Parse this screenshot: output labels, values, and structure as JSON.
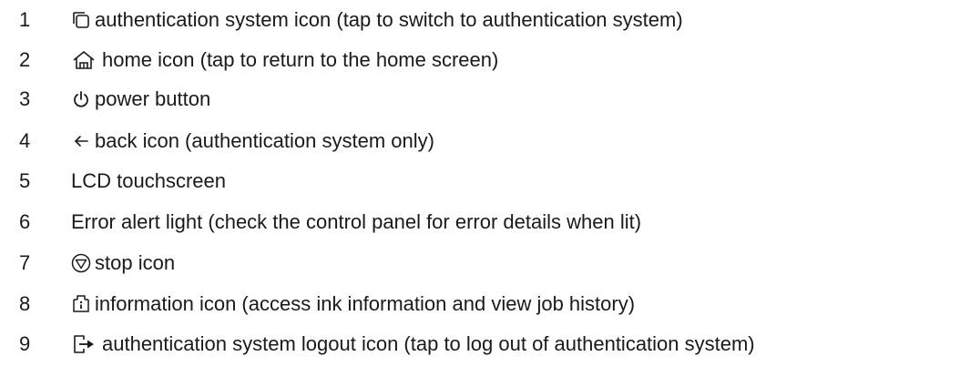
{
  "items": [
    {
      "number": "1",
      "icon": "authentication-system-icon",
      "text": "authentication system icon (tap to switch to authentication system)"
    },
    {
      "number": "2",
      "icon": "home-icon",
      "text": "home icon (tap to return to the home screen)"
    },
    {
      "number": "3",
      "icon": "power-icon",
      "text": "power button"
    },
    {
      "number": "4",
      "icon": "back-arrow-icon",
      "text": "back icon (authentication system only)"
    },
    {
      "number": "5",
      "icon": "",
      "text": "LCD touchscreen"
    },
    {
      "number": "6",
      "icon": "",
      "text": "Error alert light (check the control panel for error details when lit)"
    },
    {
      "number": "7",
      "icon": "stop-icon",
      "text": "stop icon"
    },
    {
      "number": "8",
      "icon": "information-icon",
      "text": "information icon (access ink information and view job history)"
    },
    {
      "number": "9",
      "icon": "logout-icon",
      "text": "authentication system logout icon (tap to log out of authentication system)"
    }
  ]
}
